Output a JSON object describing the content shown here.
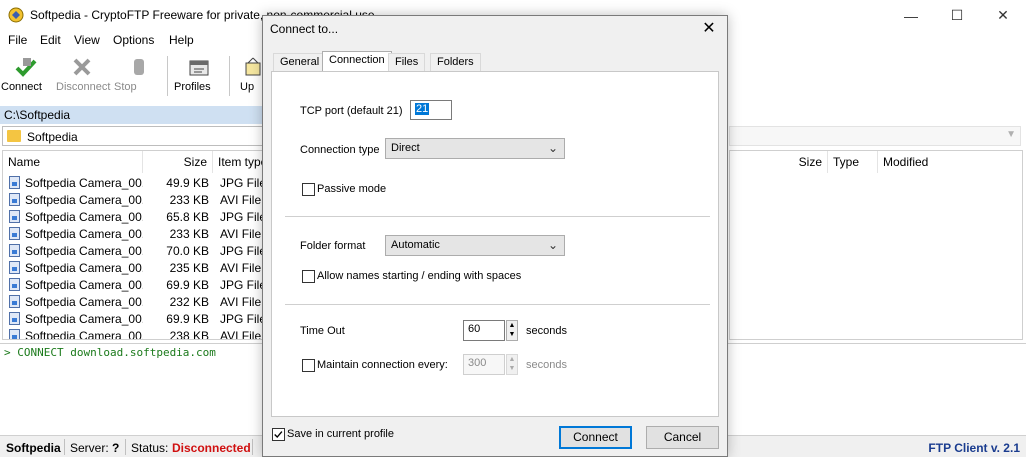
{
  "window": {
    "title": "Softpedia - CryptoFTP  Freeware for private, non-commercial use",
    "minimize": "—",
    "maximize": "☐",
    "close": "✕"
  },
  "menu": [
    "File",
    "Edit",
    "View",
    "Options",
    "Help"
  ],
  "toolbar": {
    "connect": "Connect",
    "disconnect": "Disconnect",
    "stop": "Stop",
    "profiles": "Profiles",
    "upload": "Up"
  },
  "local": {
    "path": "C:\\Softpedia",
    "folder": "Softpedia",
    "headers": {
      "name": "Name",
      "size": "Size",
      "type": "Item type"
    },
    "files": [
      {
        "name": "Softpedia Camera_00...",
        "size": "49.9 KB",
        "type": "JPG File"
      },
      {
        "name": "Softpedia Camera_00...",
        "size": "233 KB",
        "type": "AVI File"
      },
      {
        "name": "Softpedia Camera_00...",
        "size": "65.8 KB",
        "type": "JPG File"
      },
      {
        "name": "Softpedia Camera_00...",
        "size": "233 KB",
        "type": "AVI File"
      },
      {
        "name": "Softpedia Camera_00...",
        "size": "70.0 KB",
        "type": "JPG File"
      },
      {
        "name": "Softpedia Camera_00...",
        "size": "235 KB",
        "type": "AVI File"
      },
      {
        "name": "Softpedia Camera_00...",
        "size": "69.9 KB",
        "type": "JPG File"
      },
      {
        "name": "Softpedia Camera_00...",
        "size": "232 KB",
        "type": "AVI File"
      },
      {
        "name": "Softpedia Camera_00...",
        "size": "69.9 KB",
        "type": "JPG File"
      },
      {
        "name": "Softpedia Camera_00...",
        "size": "238 KB",
        "type": "AVI File"
      }
    ]
  },
  "remote": {
    "headers": {
      "size": "Size",
      "type": "Type",
      "modified": "Modified"
    }
  },
  "log": {
    "line": "> CONNECT download.softpedia.com"
  },
  "status": {
    "profile": "Softpedia",
    "server_label": "Server:",
    "server_value": "?",
    "status_label": "Status:",
    "status_value": "Disconnected",
    "client": "FTP Client v. 2.1",
    "status_color": "#d01010",
    "client_color": "#1a3c8f"
  },
  "dialog": {
    "title": "Connect to...",
    "close": "✕",
    "tabs": [
      "General",
      "Connection",
      "Files",
      "Folders"
    ],
    "active_tab": "Connection",
    "tcp_port_label": "TCP port (default 21)",
    "tcp_port_value": "21",
    "connection_type_label": "Connection type",
    "connection_type_value": "Direct",
    "passive_mode_label": "Passive mode",
    "folder_format_label": "Folder format",
    "folder_format_value": "Automatic",
    "allow_spaces_label": "Allow names starting / ending with spaces",
    "timeout_label": "Time Out",
    "timeout_value": "60",
    "timeout_unit": "seconds",
    "maintain_label": "Maintain connection every:",
    "maintain_value": "300",
    "maintain_unit": "seconds",
    "save_profile_label": "Save in current profile",
    "save_profile_checked": true,
    "connect_button": "Connect",
    "cancel_button": "Cancel"
  }
}
